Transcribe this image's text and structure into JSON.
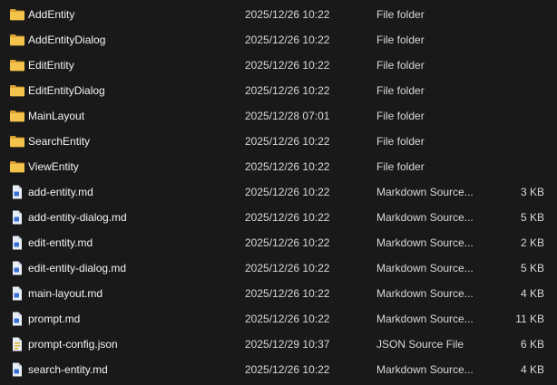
{
  "colors": {
    "background": "#191919",
    "text": "#f2f2f2",
    "folder": "#f3c34b",
    "folder_dark": "#d9a130",
    "file_icon": "#e8eef6",
    "markdown_mark": "#3a6fd4",
    "json_mark": "#e3b53a"
  },
  "files": [
    {
      "name": "AddEntity",
      "date": "2025/12/26 10:22",
      "type": "File folder",
      "size": "",
      "icon": "folder-icon"
    },
    {
      "name": "AddEntityDialog",
      "date": "2025/12/26 10:22",
      "type": "File folder",
      "size": "",
      "icon": "folder-icon"
    },
    {
      "name": "EditEntity",
      "date": "2025/12/26 10:22",
      "type": "File folder",
      "size": "",
      "icon": "folder-icon"
    },
    {
      "name": "EditEntityDialog",
      "date": "2025/12/26 10:22",
      "type": "File folder",
      "size": "",
      "icon": "folder-icon"
    },
    {
      "name": "MainLayout",
      "date": "2025/12/28 07:01",
      "type": "File folder",
      "size": "",
      "icon": "folder-icon"
    },
    {
      "name": "SearchEntity",
      "date": "2025/12/26 10:22",
      "type": "File folder",
      "size": "",
      "icon": "folder-icon"
    },
    {
      "name": "ViewEntity",
      "date": "2025/12/26 10:22",
      "type": "File folder",
      "size": "",
      "icon": "folder-icon"
    },
    {
      "name": "add-entity.md",
      "date": "2025/12/26 10:22",
      "type": "Markdown Source...",
      "size": "3 KB",
      "icon": "markdown-file-icon"
    },
    {
      "name": "add-entity-dialog.md",
      "date": "2025/12/26 10:22",
      "type": "Markdown Source...",
      "size": "5 KB",
      "icon": "markdown-file-icon"
    },
    {
      "name": "edit-entity.md",
      "date": "2025/12/26 10:22",
      "type": "Markdown Source...",
      "size": "2 KB",
      "icon": "markdown-file-icon"
    },
    {
      "name": "edit-entity-dialog.md",
      "date": "2025/12/26 10:22",
      "type": "Markdown Source...",
      "size": "5 KB",
      "icon": "markdown-file-icon"
    },
    {
      "name": "main-layout.md",
      "date": "2025/12/26 10:22",
      "type": "Markdown Source...",
      "size": "4 KB",
      "icon": "markdown-file-icon"
    },
    {
      "name": "prompt.md",
      "date": "2025/12/26 10:22",
      "type": "Markdown Source...",
      "size": "11 KB",
      "icon": "markdown-file-icon"
    },
    {
      "name": "prompt-config.json",
      "date": "2025/12/29 10:37",
      "type": "JSON Source File",
      "size": "6 KB",
      "icon": "json-file-icon"
    },
    {
      "name": "search-entity.md",
      "date": "2025/12/26 10:22",
      "type": "Markdown Source...",
      "size": "4 KB",
      "icon": "markdown-file-icon"
    }
  ]
}
